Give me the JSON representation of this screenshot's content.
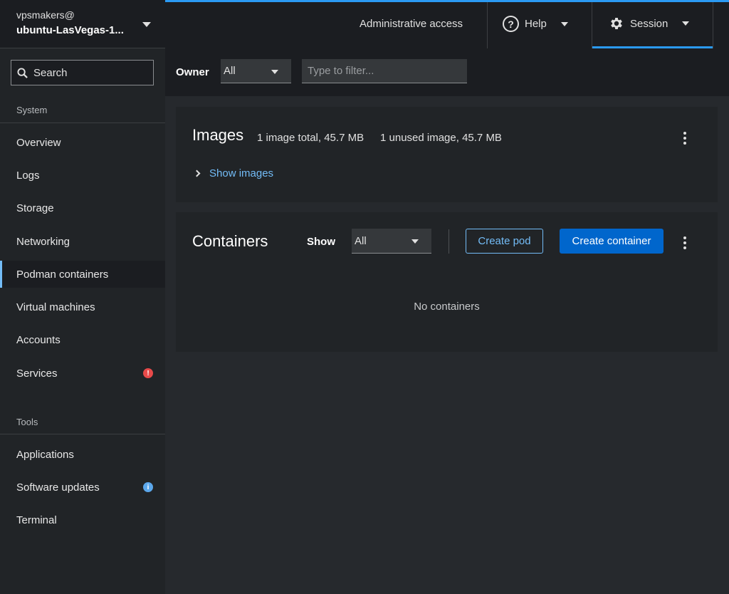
{
  "host": {
    "user": "vpsmakers@",
    "name": "ubuntu-LasVegas-1..."
  },
  "search": {
    "label": "Search"
  },
  "sidebar": {
    "system_title": "System",
    "tools_title": "Tools",
    "system_items": [
      {
        "label": "Overview"
      },
      {
        "label": "Logs"
      },
      {
        "label": "Storage"
      },
      {
        "label": "Networking"
      },
      {
        "label": "Podman containers",
        "active": true
      },
      {
        "label": "Virtual machines"
      },
      {
        "label": "Accounts"
      },
      {
        "label": "Services",
        "badge": "!"
      }
    ],
    "tool_items": [
      {
        "label": "Applications"
      },
      {
        "label": "Software updates",
        "badge": "i"
      },
      {
        "label": "Terminal"
      }
    ]
  },
  "topbar": {
    "admin": "Administrative access",
    "help": "Help",
    "session": "Session"
  },
  "filter": {
    "owner_label": "Owner",
    "owner_value": "All",
    "filter_placeholder": "Type to filter..."
  },
  "images": {
    "title": "Images",
    "total": "1 image total, 45.7 MB",
    "unused": "1 unused image, 45.7 MB",
    "toggle": "Show images"
  },
  "containers": {
    "title": "Containers",
    "show_label": "Show",
    "show_value": "All",
    "create_pod": "Create pod",
    "create_container": "Create container",
    "empty": "No containers"
  },
  "colors": {
    "accent": "#2b9af3",
    "primary_button": "#0066cc",
    "link": "#73bcf7",
    "danger": "#e84a4a"
  }
}
